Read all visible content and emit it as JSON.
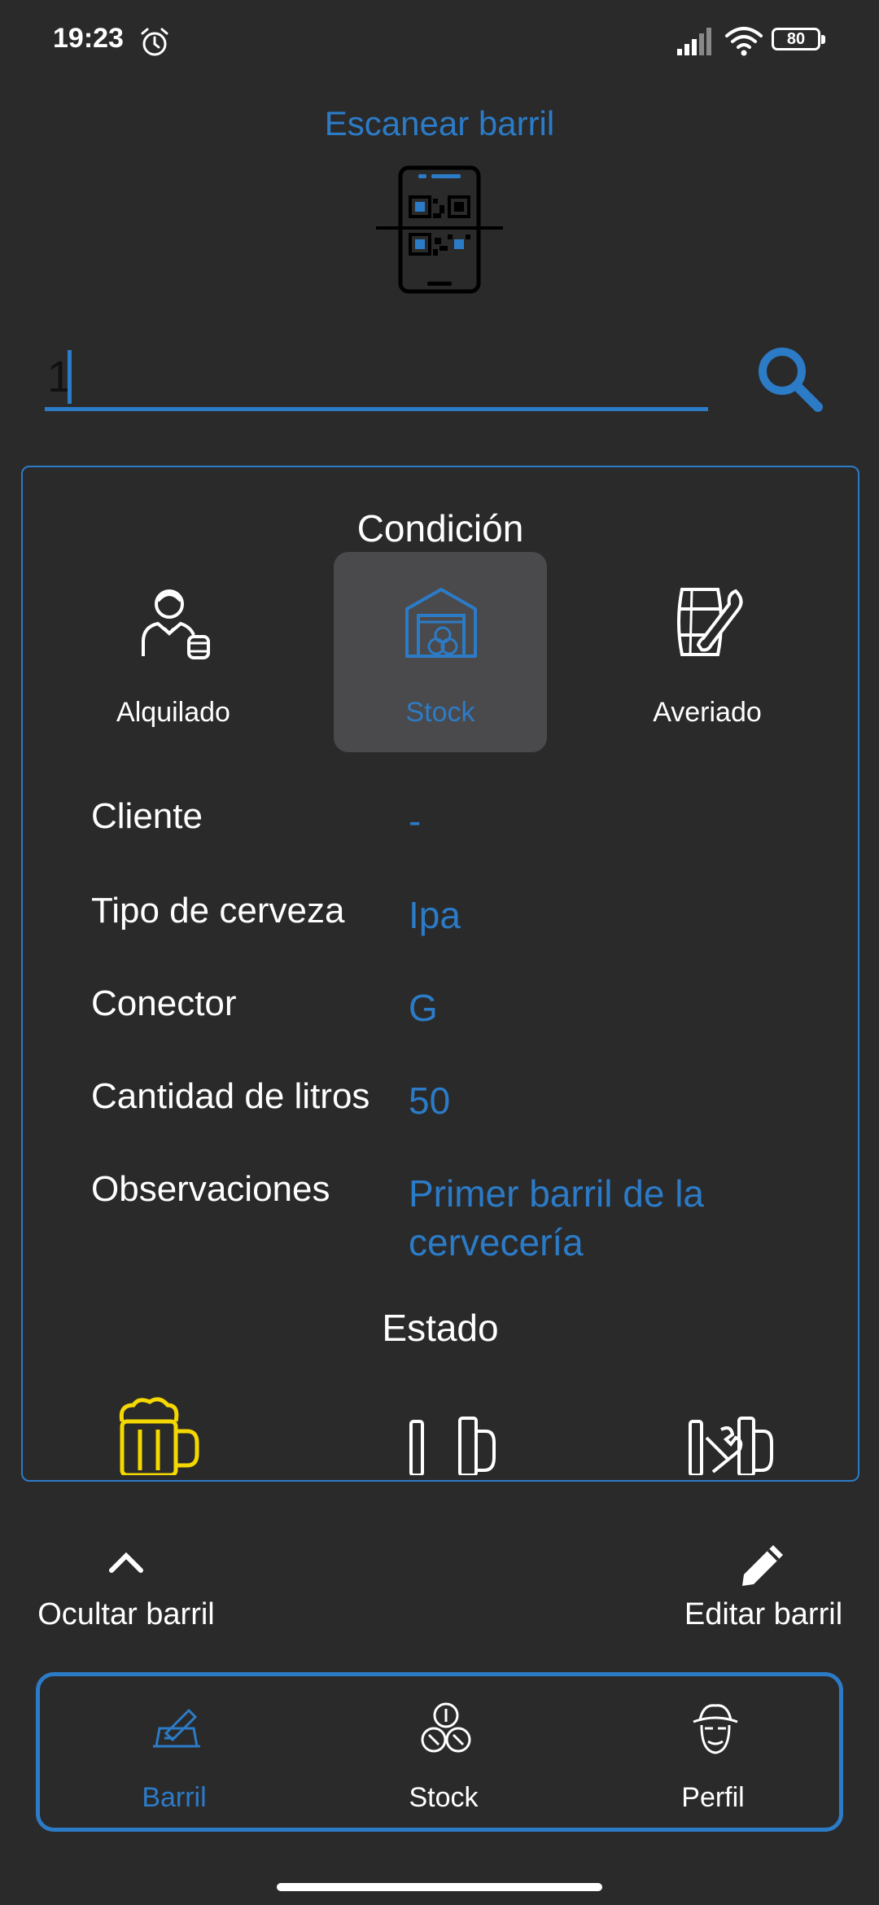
{
  "status_bar": {
    "time": "19:23",
    "battery": "80"
  },
  "scan": {
    "title": "Escanear barril"
  },
  "search": {
    "value": "1"
  },
  "condition": {
    "title": "Condición",
    "options": [
      {
        "label": "Alquilado",
        "icon": "waiter-icon"
      },
      {
        "label": "Stock",
        "icon": "warehouse-icon",
        "selected": true
      },
      {
        "label": "Averiado",
        "icon": "barrel-wrench-icon"
      }
    ]
  },
  "details": {
    "client_label": "Cliente",
    "client_value": "-",
    "beer_label": "Tipo de cerveza",
    "beer_value": "Ipa",
    "connector_label": "Conector",
    "connector_value": "G",
    "liters_label": "Cantidad de litros",
    "liters_value": "50",
    "notes_label": "Observaciones",
    "notes_value": "Primer barril de la cervecería"
  },
  "estado": {
    "title": "Estado"
  },
  "actions": {
    "hide_label": "Ocultar barril",
    "edit_label": "Editar barril"
  },
  "bottom_nav": {
    "items": [
      {
        "label": "Barril",
        "active": true
      },
      {
        "label": "Stock"
      },
      {
        "label": "Perfil"
      }
    ]
  },
  "colors": {
    "accent": "#2c7bc7",
    "background": "#2a2a2b",
    "selected_bg": "#4a4a4c",
    "estado_full": "#f5d800"
  }
}
